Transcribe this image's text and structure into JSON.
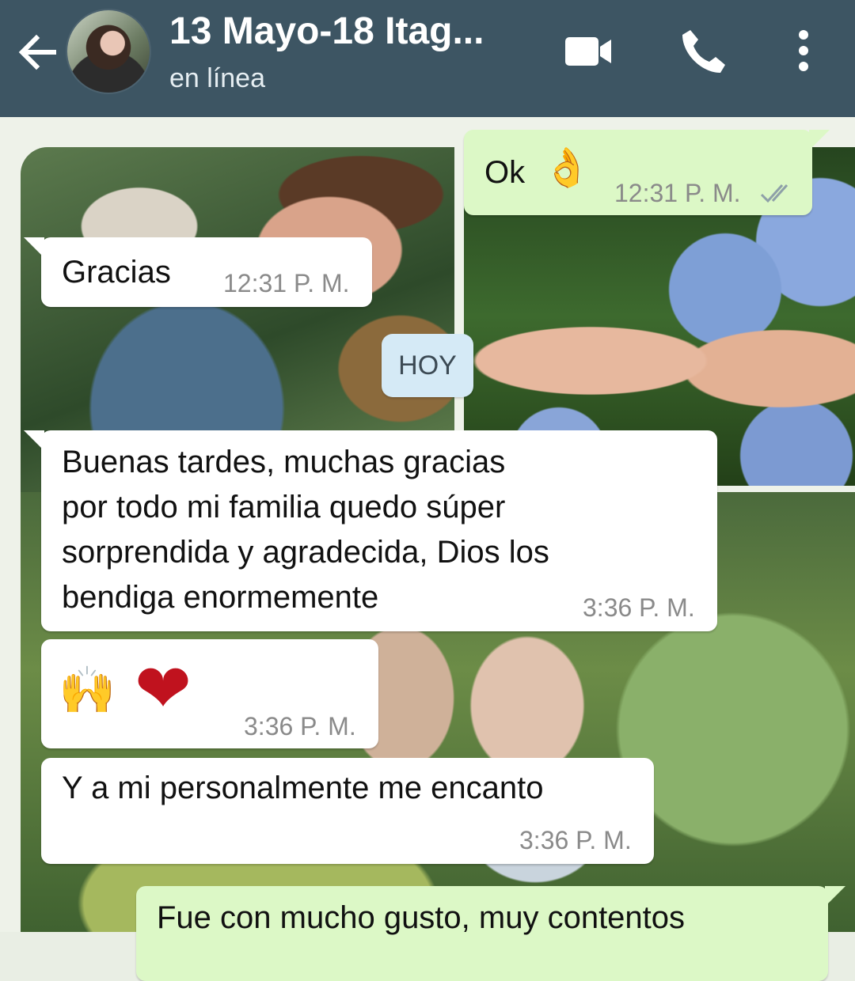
{
  "header": {
    "title": "13 Mayo-18 Itag...",
    "status": "en línea",
    "background": "#3d5563"
  },
  "chat": {
    "date_chip": "HOY",
    "messages": [
      {
        "direction": "out",
        "text": "Ok",
        "emoji": "👌",
        "time": "12:31 P. M.",
        "read": true
      },
      {
        "direction": "in",
        "text": "Gracias",
        "time": "12:31 P. M."
      },
      {
        "direction": "in",
        "lines": [
          "Buenas tardes, muchas gracias",
          "por todo mi familia quedo súper",
          "sorprendida y agradecida, Dios los",
          "bendiga enormemente"
        ],
        "time": "3:36 P. M."
      },
      {
        "direction": "in",
        "emoji": [
          "🙌",
          "❤"
        ],
        "time": "3:36 P. M."
      },
      {
        "direction": "in",
        "text": "Y a mi personalmente me encanto",
        "time": "3:36 P. M."
      },
      {
        "direction": "out",
        "text": "Fue con mucho gusto, muy contentos"
      }
    ]
  },
  "icons": [
    "back-arrow-icon",
    "video-call-icon",
    "phone-icon",
    "more-options-icon",
    "double-check-icon"
  ],
  "colors": {
    "incoming": "#ffffff",
    "outgoing": "#dcf8c6",
    "tick": "#8ea0a8",
    "chip": "#d5eaf6"
  }
}
